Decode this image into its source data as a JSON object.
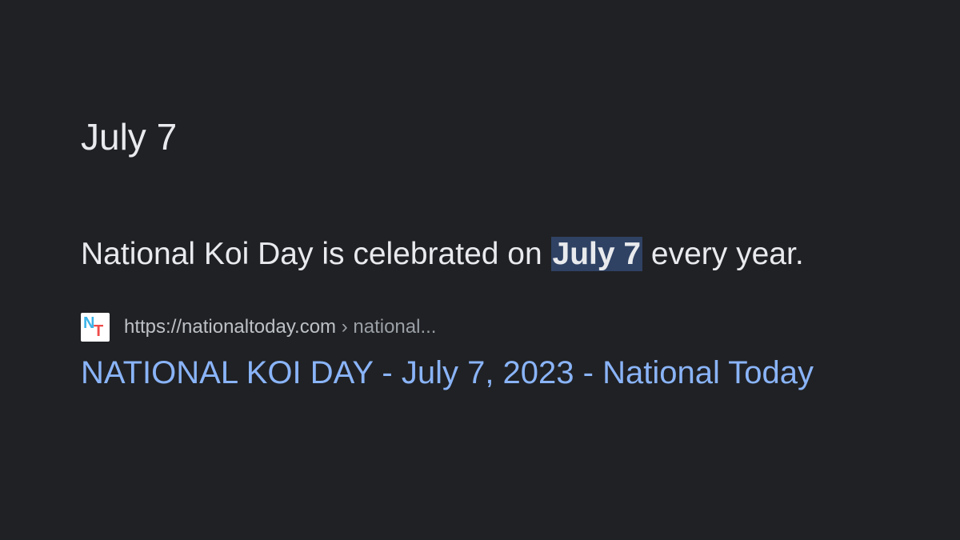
{
  "featured_snippet": {
    "answer": "July 7",
    "sentence_before": "National Koi Day is celebrated on ",
    "sentence_highlight": "July 7",
    "sentence_after": " every year."
  },
  "source": {
    "favicon": "nationaltoday-favicon",
    "favicon_letter_1": "N",
    "favicon_letter_2": "T",
    "url": "https://nationaltoday.com",
    "breadcrumb": " › national...",
    "title": "NATIONAL KOI DAY - July 7, 2023 - National Today"
  },
  "colors": {
    "background": "#202124",
    "text": "#e8eaed",
    "highlight_bg": "#2f4264",
    "link": "#8ab4f8",
    "url": "#bdc1c6"
  }
}
